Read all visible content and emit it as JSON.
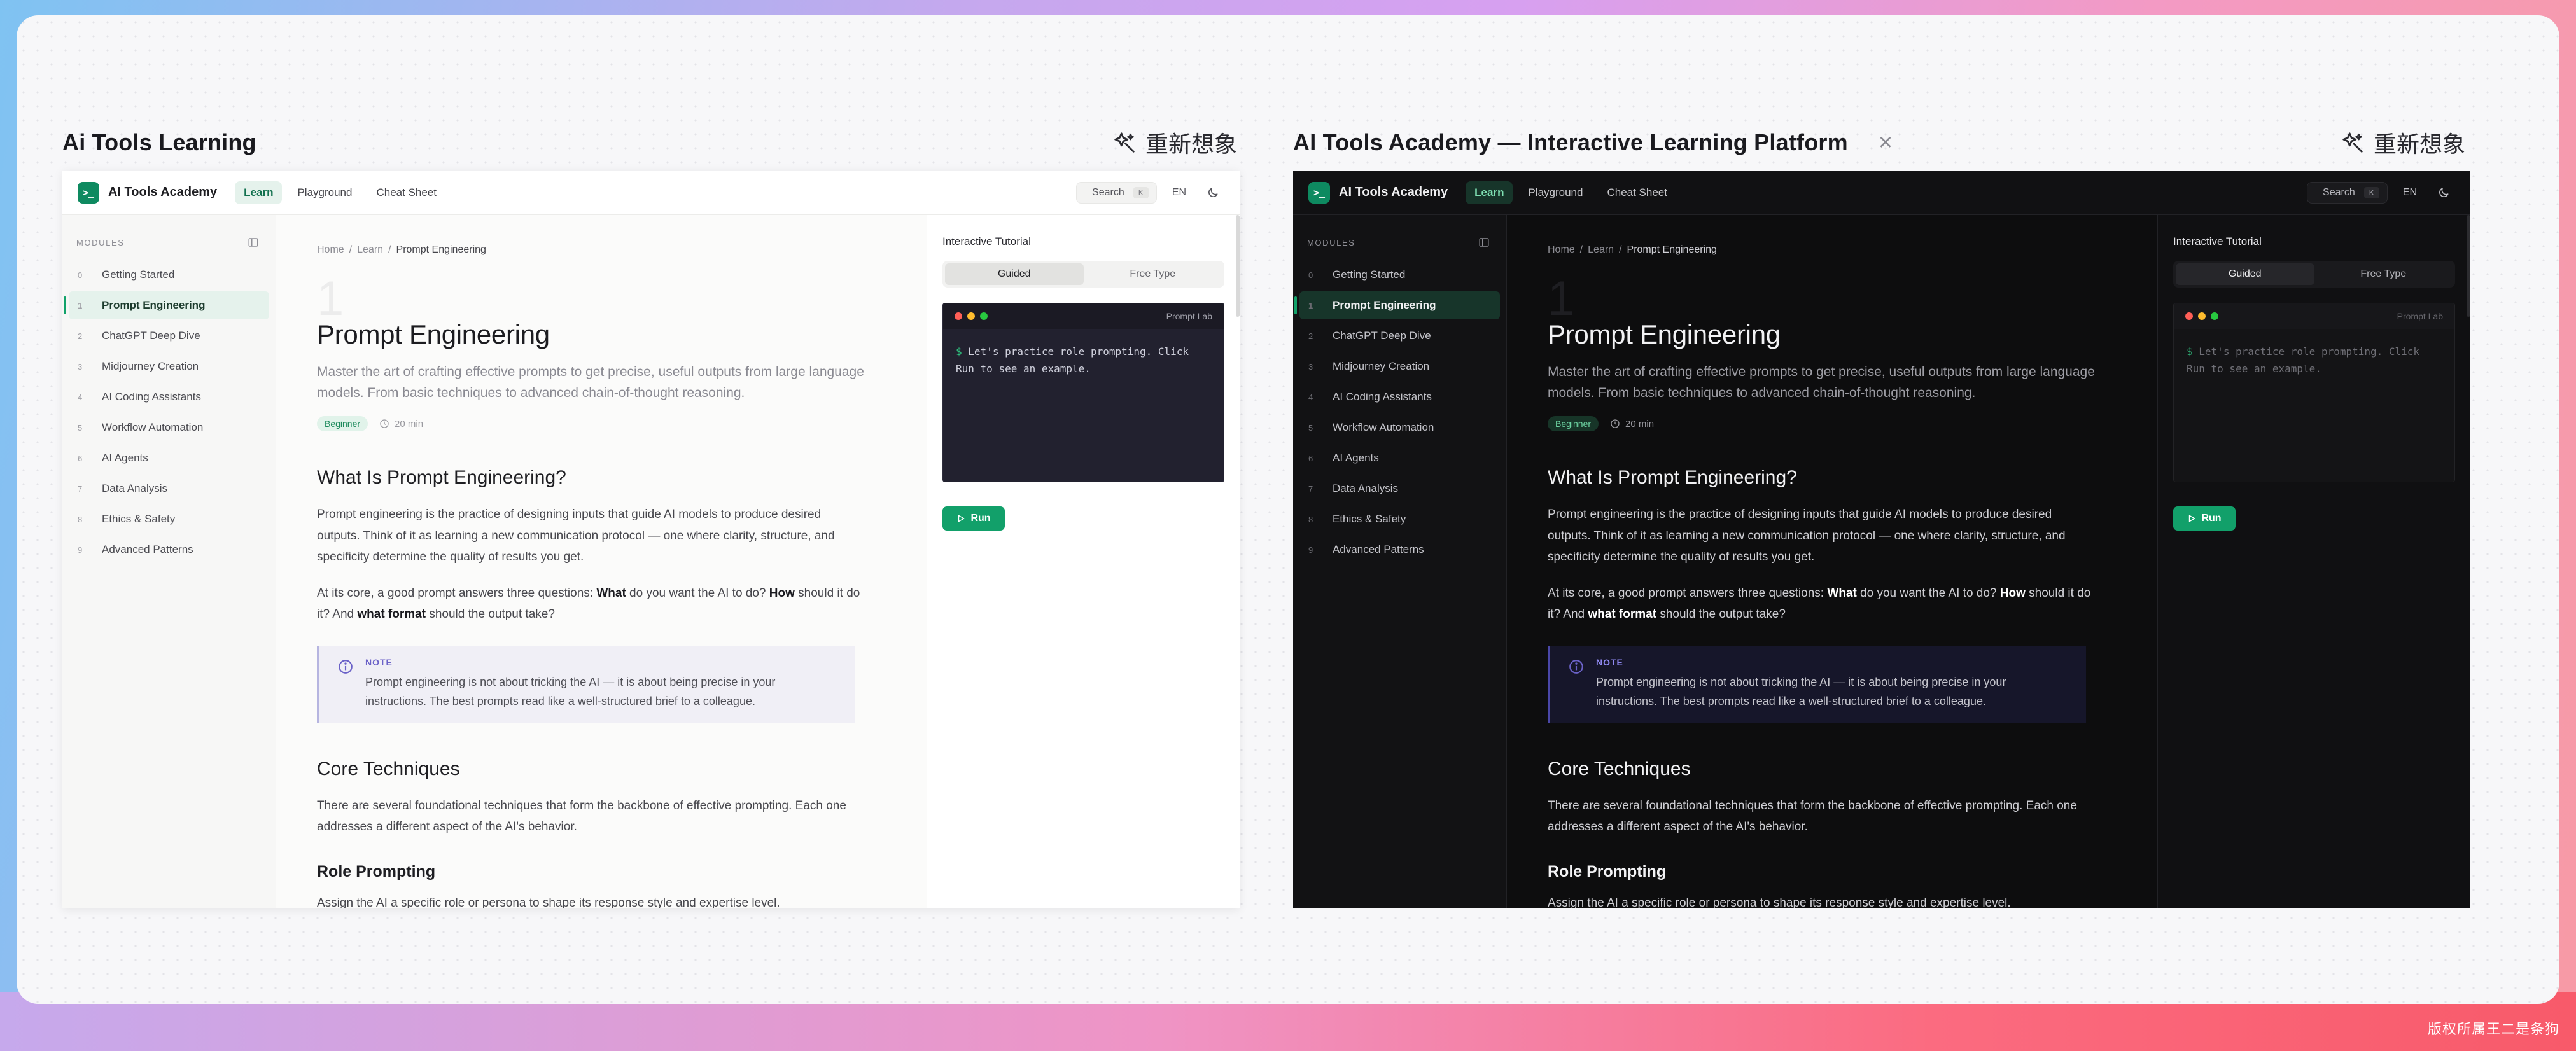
{
  "watermark": "版权所属王二是条狗",
  "panels": [
    {
      "title": "Ai Tools Learning",
      "reimagine_label": "重新想象",
      "app": {
        "brand": "AI Tools Academy",
        "nav": [
          "Learn",
          "Playground",
          "Cheat Sheet"
        ],
        "search": "Search",
        "search_kbd": "K",
        "lang": "EN",
        "modules_heading": "MODULES",
        "modules": [
          {
            "num": "0",
            "label": "Getting Started"
          },
          {
            "num": "1",
            "label": "Prompt Engineering"
          },
          {
            "num": "2",
            "label": "ChatGPT Deep Dive"
          },
          {
            "num": "3",
            "label": "Midjourney Creation"
          },
          {
            "num": "4",
            "label": "AI Coding Assistants"
          },
          {
            "num": "5",
            "label": "Workflow Automation"
          },
          {
            "num": "6",
            "label": "AI Agents"
          },
          {
            "num": "7",
            "label": "Data Analysis"
          },
          {
            "num": "8",
            "label": "Ethics & Safety"
          },
          {
            "num": "9",
            "label": "Advanced Patterns"
          }
        ],
        "breadcrumb": [
          "Home",
          "/",
          "Learn",
          "/",
          "Prompt Engineering"
        ],
        "big_number": "1",
        "title": "Prompt Engineering",
        "lead": "Master the art of crafting effective prompts to get precise, useful outputs from large language models. From basic techniques to advanced chain-of-thought reasoning.",
        "badge": "Beginner",
        "duration": "20 min",
        "h2_what": "What Is Prompt Engineering?",
        "p1": "Prompt engineering is the practice of designing inputs that guide AI models to produce desired outputs. Think of it as learning a new communication protocol — one where clarity, structure, and specificity determine the quality of results you get.",
        "p2_start": "At its core, a good prompt answers three questions: ",
        "p2_what": "What",
        "p2_mid1": " do you want the AI to do? ",
        "p2_how": "How",
        "p2_mid2": " should it do it? And ",
        "p2_format": "what format",
        "p2_end": " should the output take?",
        "note_label": "NOTE",
        "note_text": "Prompt engineering is not about tricking the AI — it is about being precise in your instructions. The best prompts read like a well-structured brief to a colleague.",
        "h2_core": "Core Techniques",
        "p3": "There are several foundational techniques that form the backbone of effective prompting. Each one addresses a different aspect of the AI's behavior.",
        "h3_role": "Role Prompting",
        "p4": "Assign the AI a specific role or persona to shape its response style and expertise level.",
        "tutorial_title": "Interactive Tutorial",
        "tabs": [
          "Guided",
          "Free Type"
        ],
        "terminal_label": "Prompt Lab",
        "terminal_prompt": "$",
        "terminal_text": "Let's practice role prompting. Click Run to see an example.",
        "run_label": "Run"
      }
    },
    {
      "title": "AI Tools Academy — Interactive Learning Platform",
      "close_label": "×",
      "reimagine_label": "重新想象",
      "app": {
        "brand": "AI Tools Academy",
        "nav": [
          "Learn",
          "Playground",
          "Cheat Sheet"
        ],
        "search": "Search",
        "search_kbd": "K",
        "lang": "EN",
        "modules_heading": "MODULES",
        "modules": [
          {
            "num": "0",
            "label": "Getting Started"
          },
          {
            "num": "1",
            "label": "Prompt Engineering"
          },
          {
            "num": "2",
            "label": "ChatGPT Deep Dive"
          },
          {
            "num": "3",
            "label": "Midjourney Creation"
          },
          {
            "num": "4",
            "label": "AI Coding Assistants"
          },
          {
            "num": "5",
            "label": "Workflow Automation"
          },
          {
            "num": "6",
            "label": "AI Agents"
          },
          {
            "num": "7",
            "label": "Data Analysis"
          },
          {
            "num": "8",
            "label": "Ethics & Safety"
          },
          {
            "num": "9",
            "label": "Advanced Patterns"
          }
        ],
        "breadcrumb": [
          "Home",
          "/",
          "Learn",
          "/",
          "Prompt Engineering"
        ],
        "big_number": "1",
        "title": "Prompt Engineering",
        "lead": "Master the art of crafting effective prompts to get precise, useful outputs from large language models. From basic techniques to advanced chain-of-thought reasoning.",
        "badge": "Beginner",
        "duration": "20 min",
        "h2_what": "What Is Prompt Engineering?",
        "p1": "Prompt engineering is the practice of designing inputs that guide AI models to produce desired outputs. Think of it as learning a new communication protocol — one where clarity, structure, and specificity determine the quality of results you get.",
        "p2_start": "At its core, a good prompt answers three questions: ",
        "p2_what": "What",
        "p2_mid1": " do you want the AI to do? ",
        "p2_how": "How",
        "p2_mid2": " should it do it? And ",
        "p2_format": "what format",
        "p2_end": " should the output take?",
        "note_label": "NOTE",
        "note_text": "Prompt engineering is not about tricking the AI — it is about being precise in your instructions. The best prompts read like a well-structured brief to a colleague.",
        "h2_core": "Core Techniques",
        "p3": "There are several foundational techniques that form the backbone of effective prompting. Each one addresses a different aspect of the AI's behavior.",
        "h3_role": "Role Prompting",
        "p4": "Assign the AI a specific role or persona to shape its response style and expertise level.",
        "tutorial_title": "Interactive Tutorial",
        "tabs": [
          "Guided",
          "Free Type"
        ],
        "terminal_label": "Prompt Lab",
        "terminal_prompt": "$",
        "terminal_text": "Let's practice role prompting. Click Run to see an example.",
        "run_label": "Run"
      }
    }
  ],
  "colors": {
    "accent_green": "#12a06a",
    "active_bg_light": "#e5f2ec",
    "active_bg_dark": "#17352a",
    "note_accent": "#6b62c8",
    "terminal_red": "#ff5f57",
    "terminal_yellow": "#febc2e",
    "terminal_green": "#28c840"
  },
  "icons": {
    "reimagine": "sparkle-wand-icon",
    "logo": "terminal-prompt-icon",
    "theme": "moon-icon",
    "sidebar_toggle": "sidebar-panel-icon",
    "clock": "clock-icon",
    "note": "info-icon",
    "run": "play-icon"
  }
}
